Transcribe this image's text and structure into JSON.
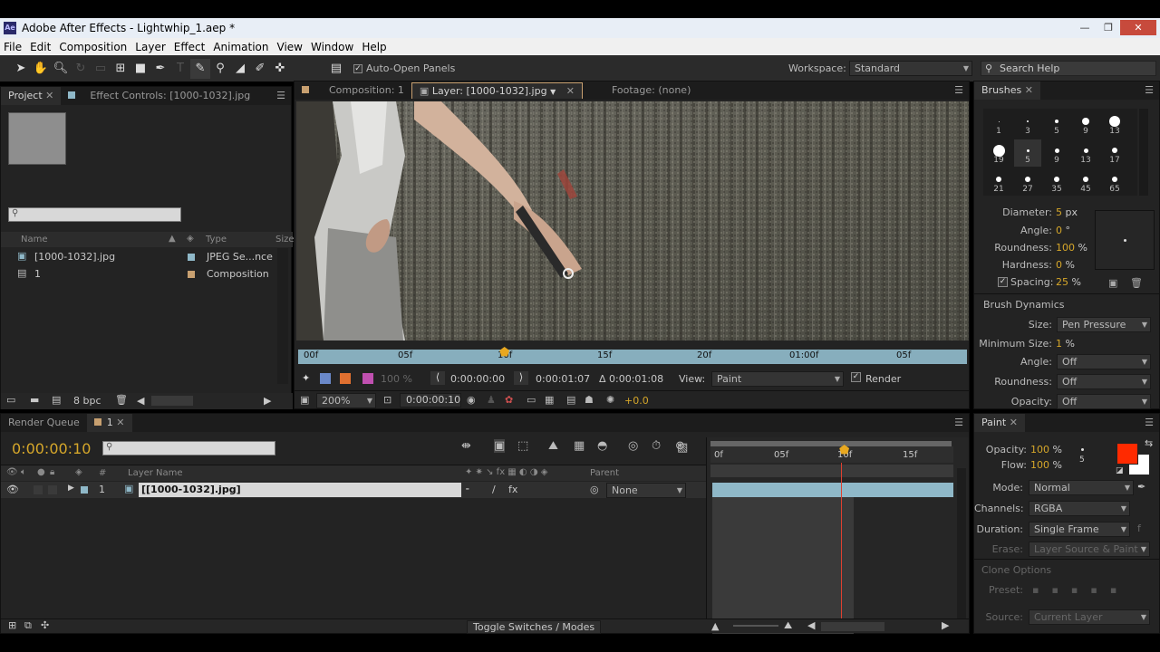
{
  "titlebar": {
    "title": "Adobe After Effects - Lightwhip_1.aep *",
    "app_icon": "Ae"
  },
  "menu": [
    "File",
    "Edit",
    "Composition",
    "Layer",
    "Effect",
    "Animation",
    "View",
    "Window",
    "Help"
  ],
  "toolbar": {
    "auto_open_label": "Auto-Open Panels",
    "workspace_label": "Workspace:",
    "workspace_value": "Standard",
    "search_placeholder": "Search Help"
  },
  "project": {
    "tab_project": "Project",
    "tab_effect_controls": "Effect Controls: [1000-1032].jpg",
    "columns": {
      "name": "Name",
      "type": "Type",
      "size": "Size"
    },
    "items": [
      {
        "name": "[1000-1032].jpg",
        "type": "JPEG Se...nce",
        "swatch": "#8fb8c8"
      },
      {
        "name": "1",
        "type": "Composition",
        "swatch": "#c8a070"
      }
    ],
    "bpc": "8 bpc"
  },
  "viewer": {
    "tab_composition": "Composition: 1",
    "tab_layer": "Layer: [1000-1032].jpg",
    "tab_footage": "Footage: (none)",
    "ruler": [
      "00f",
      "05f",
      "10f",
      "15f",
      "20f",
      "01:00f",
      "05f"
    ],
    "zoom_pct": "100 %",
    "time_start": "0:00:00:00",
    "time_end": "0:00:01:07",
    "time_delta": "Δ 0:00:01:08",
    "view_label": "View:",
    "view_value": "Paint",
    "render_label": "Render",
    "zoom": "200%",
    "current_time": "0:00:00:10",
    "exposure": "+0.0"
  },
  "brushes": {
    "tab": "Brushes",
    "presets": [
      {
        "label": "1",
        "size": 1
      },
      {
        "label": "3",
        "size": 2
      },
      {
        "label": "5",
        "size": 4
      },
      {
        "label": "9",
        "size": 8
      },
      {
        "label": "13",
        "size": 12
      },
      {
        "label": "19",
        "size": 13
      },
      {
        "label": "5",
        "size": 3
      },
      {
        "label": "9",
        "size": 5
      },
      {
        "label": "13",
        "size": 5
      },
      {
        "label": "17",
        "size": 6
      },
      {
        "label": "21",
        "size": 6
      },
      {
        "label": "27",
        "size": 6
      },
      {
        "label": "35",
        "size": 6
      },
      {
        "label": "45",
        "size": 6
      },
      {
        "label": "65",
        "size": 6
      }
    ],
    "diameter_label": "Diameter:",
    "diameter_value": "5",
    "diameter_unit": "px",
    "angle_label": "Angle:",
    "angle_value": "0",
    "angle_unit": "°",
    "roundness_label": "Roundness:",
    "roundness_value": "100",
    "roundness_unit": "%",
    "hardness_label": "Hardness:",
    "hardness_value": "0",
    "hardness_unit": "%",
    "spacing_label": "Spacing:",
    "spacing_value": "25",
    "spacing_unit": "%",
    "dynamics_title": "Brush Dynamics",
    "dyn_size_label": "Size:",
    "dyn_size_value": "Pen Pressure",
    "min_size_label": "Minimum Size:",
    "min_size_value": "1",
    "min_size_unit": "%",
    "dyn_angle_label": "Angle:",
    "dyn_angle_value": "Off",
    "dyn_roundness_label": "Roundness:",
    "dyn_roundness_value": "Off",
    "dyn_opacity_label": "Opacity:",
    "dyn_opacity_value": "Off"
  },
  "timeline": {
    "tab_render_queue": "Render Queue",
    "tab_comp": "1",
    "timecode": "0:00:00:10",
    "col_layer_name": "Layer Name",
    "col_parent": "Parent",
    "col_hash": "#",
    "ruler": [
      "0f",
      "05f",
      "10f",
      "15f"
    ],
    "layer": {
      "index": "1",
      "name": "[[1000-1032].jpg]",
      "parent": "None"
    },
    "toggle_label": "Toggle Switches / Modes"
  },
  "paint": {
    "tab": "Paint",
    "opacity_label": "Opacity:",
    "opacity_value": "100",
    "opacity_unit": "%",
    "flow_label": "Flow:",
    "flow_value": "100",
    "flow_unit": "%",
    "brush_size": "5",
    "fg_color": "#ff2a00",
    "bg_color": "#ffffff",
    "mode_label": "Mode:",
    "mode_value": "Normal",
    "channels_label": "Channels:",
    "channels_value": "RGBA",
    "duration_label": "Duration:",
    "duration_value": "Single Frame",
    "erase_label": "Erase:",
    "erase_value": "Layer Source & Paint",
    "clone_options": "Clone Options",
    "preset_label": "Preset:",
    "source_label": "Source:",
    "source_value": "Current Layer"
  }
}
